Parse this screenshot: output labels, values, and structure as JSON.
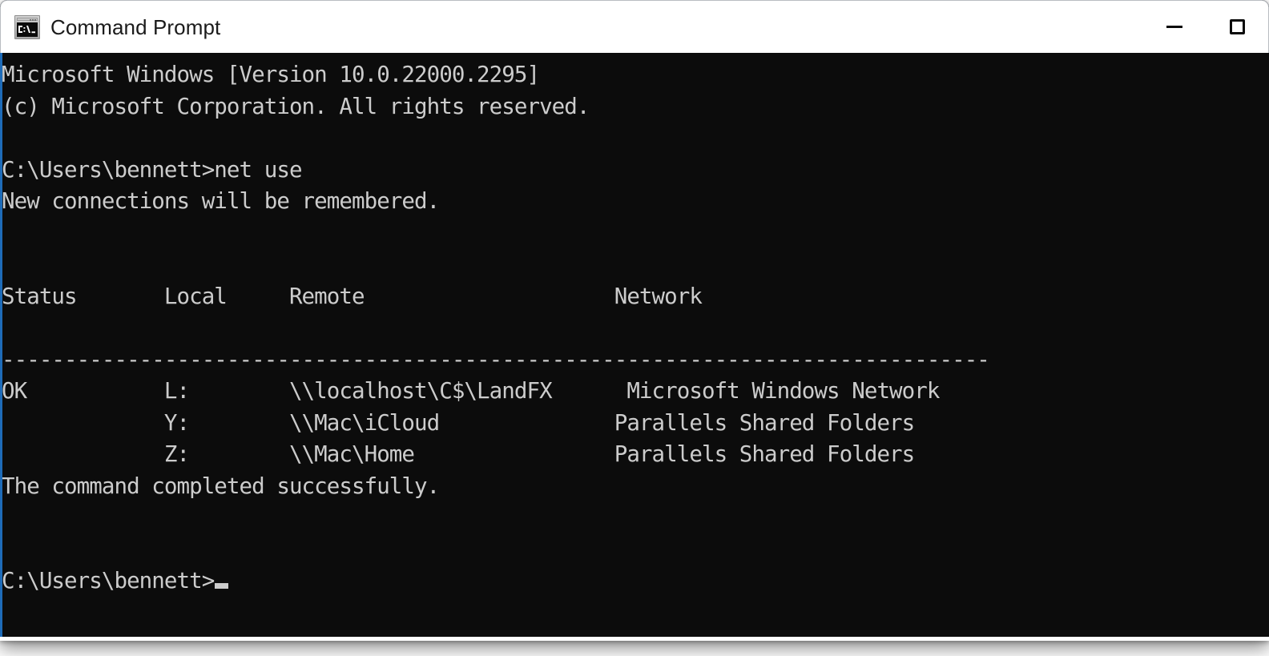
{
  "window": {
    "title": "Command Prompt",
    "app_icon": "command-prompt-icon",
    "icon_text": "C:\\",
    "accent_color": "#1e6bb8",
    "titlebar_background": "#ffffff",
    "titlebar_text_color": "#1b1b1b"
  },
  "window_controls": {
    "minimize": {
      "label": "Minimize",
      "icon": "minimize-icon"
    },
    "maximize": {
      "label": "Maximize",
      "icon": "maximize-icon"
    }
  },
  "terminal": {
    "background": "#0c0c0c",
    "foreground": "#cccccc",
    "cursor": "block-cursor",
    "lines": [
      "Microsoft Windows [Version 10.0.22000.2295]",
      "(c) Microsoft Corporation. All rights reserved.",
      "",
      "C:\\Users\\bennett>net use",
      "New connections will be remembered.",
      "",
      "",
      "Status       Local     Remote                    Network",
      "",
      "-------------------------------------------------------------------------------",
      "OK           L:        \\\\localhost\\C$\\LandFX      Microsoft Windows Network",
      "             Y:        \\\\Mac\\iCloud              Parallels Shared Folders",
      "             Z:        \\\\Mac\\Home                Parallels Shared Folders",
      "The command completed successfully.",
      "",
      "",
      ""
    ],
    "prompt_line": "C:\\Users\\bennett>"
  },
  "net_use_output": {
    "command": "net use",
    "notice": "New connections will be remembered.",
    "columns": [
      "Status",
      "Local",
      "Remote",
      "Network"
    ],
    "rows": [
      {
        "status": "OK",
        "local": "L:",
        "remote": "\\\\localhost\\C$\\LandFX",
        "network": "Microsoft Windows Network"
      },
      {
        "status": "",
        "local": "Y:",
        "remote": "\\\\Mac\\iCloud",
        "network": "Parallels Shared Folders"
      },
      {
        "status": "",
        "local": "Z:",
        "remote": "\\\\Mac\\Home",
        "network": "Parallels Shared Folders"
      }
    ],
    "result": "The command completed successfully."
  },
  "banner": {
    "os": "Microsoft Windows [Version 10.0.22000.2295]",
    "copyright": "(c) Microsoft Corporation. All rights reserved."
  }
}
